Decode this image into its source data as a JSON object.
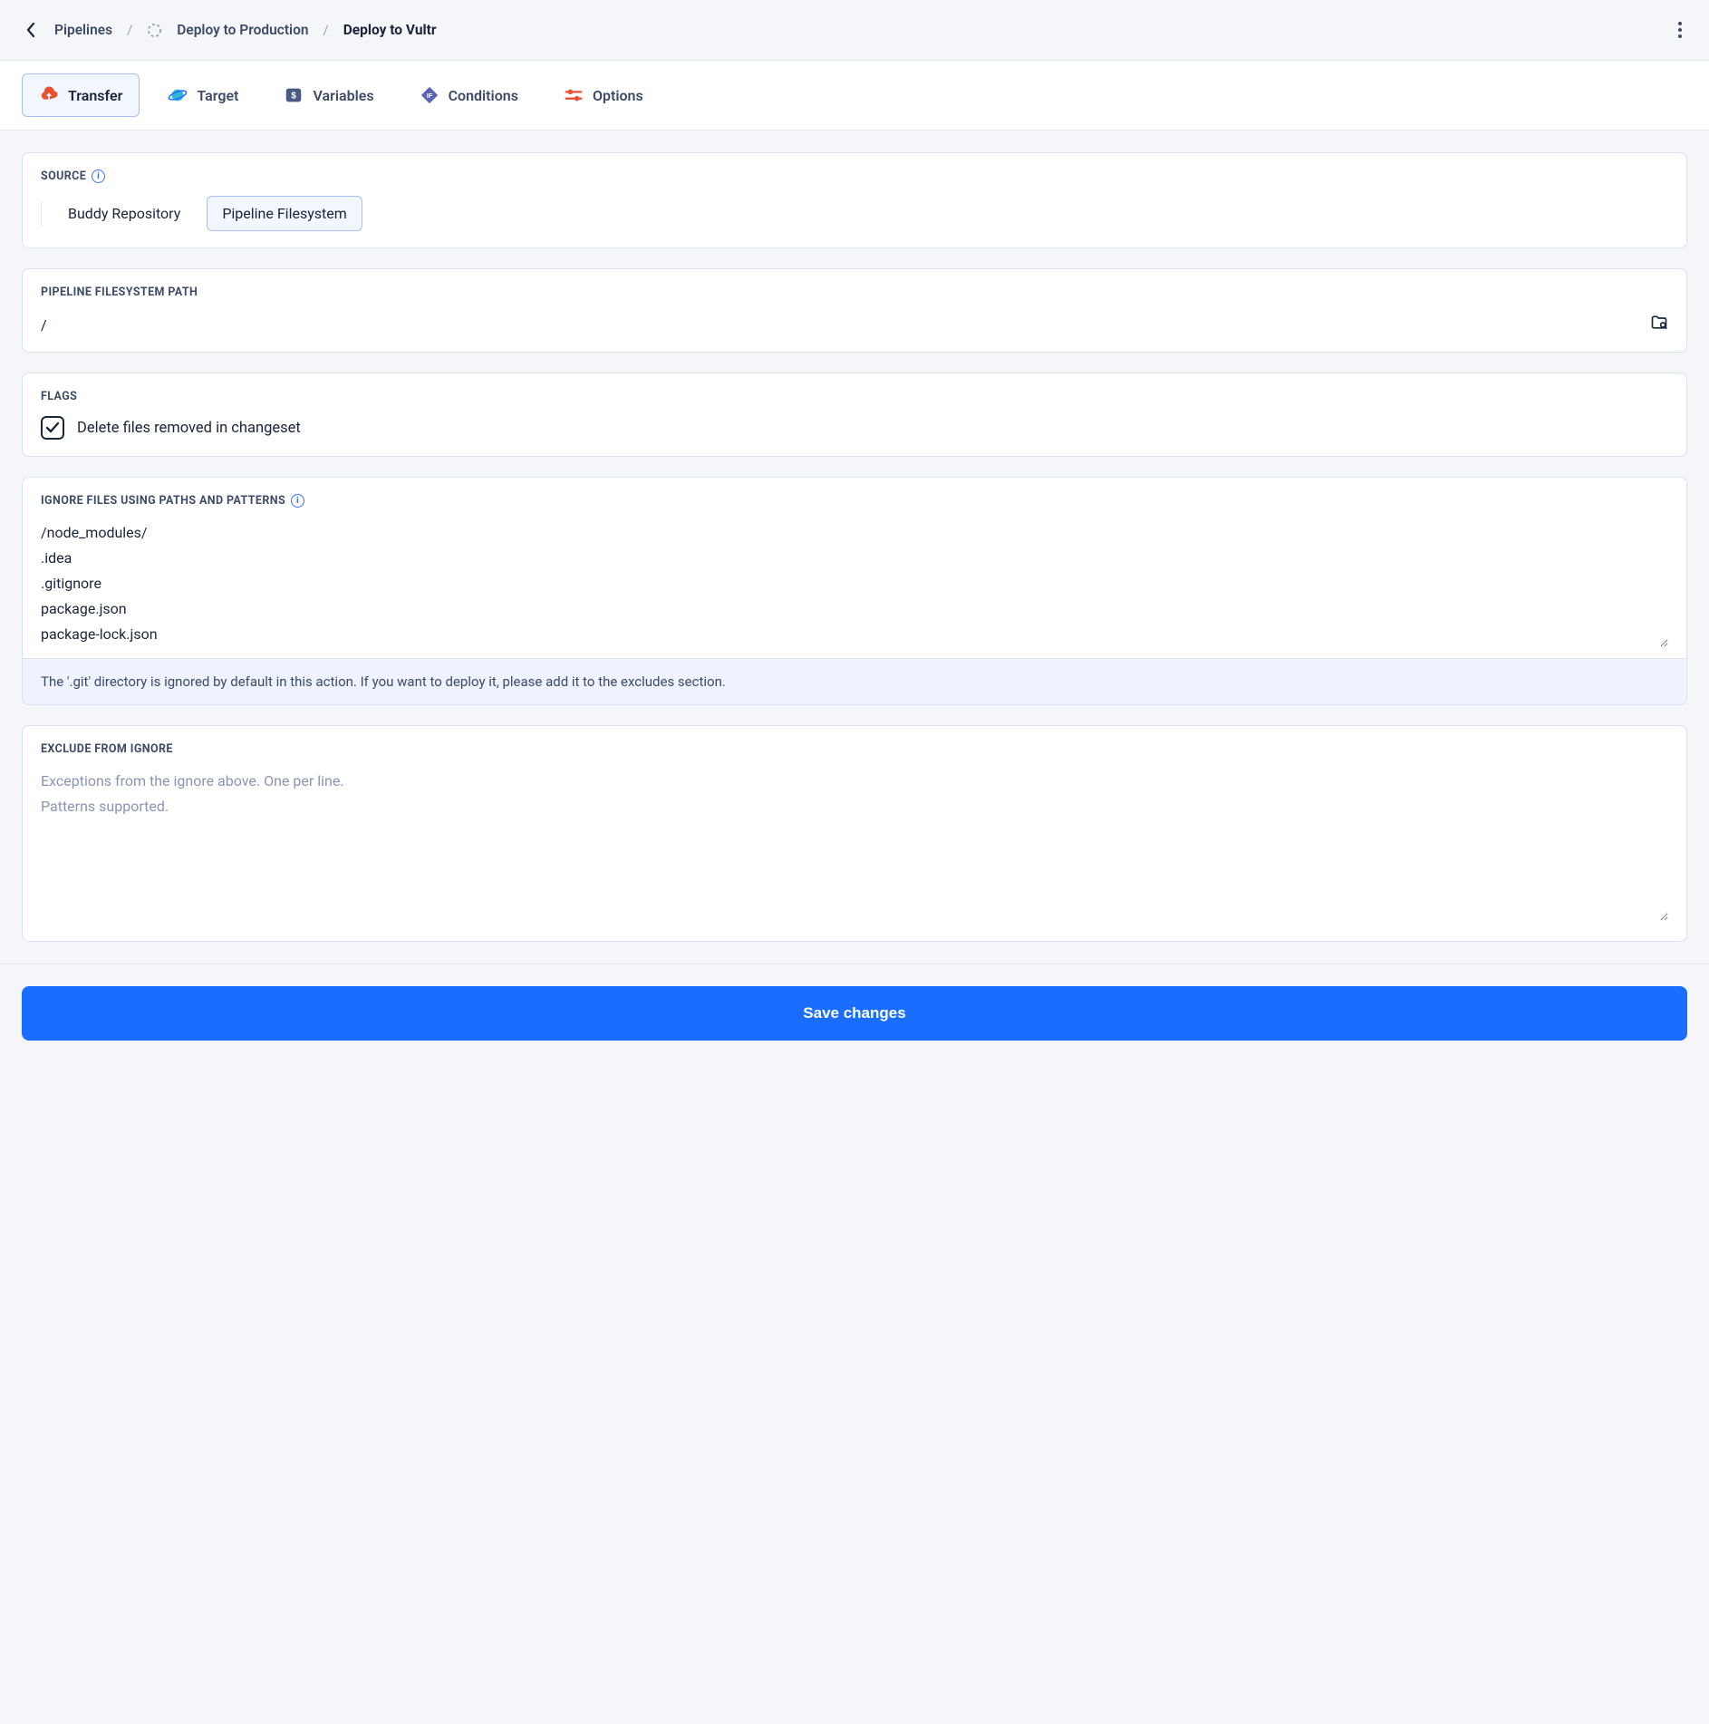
{
  "breadcrumb": {
    "root": "Pipelines",
    "parent": "Deploy to Production",
    "current": "Deploy to Vultr"
  },
  "tabs": [
    {
      "label": "Transfer",
      "active": true
    },
    {
      "label": "Target",
      "active": false
    },
    {
      "label": "Variables",
      "active": false
    },
    {
      "label": "Conditions",
      "active": false
    },
    {
      "label": "Options",
      "active": false
    }
  ],
  "source": {
    "label": "SOURCE",
    "options": [
      "Buddy Repository",
      "Pipeline Filesystem"
    ],
    "selected": "Pipeline Filesystem"
  },
  "path": {
    "label": "PIPELINE FILESYSTEM PATH",
    "value": "/"
  },
  "flags": {
    "label": "FLAGS",
    "delete_removed": {
      "label": "Delete files removed in changeset",
      "checked": true
    }
  },
  "ignore": {
    "label": "IGNORE FILES USING PATHS AND PATTERNS",
    "value": "/node_modules/\n.idea\n.gitignore\npackage.json\npackage-lock.json",
    "help": "The '.git' directory is ignored by default in this action. If you want to deploy it, please add it to the excludes section."
  },
  "exclude": {
    "label": "EXCLUDE FROM IGNORE",
    "placeholder": "Exceptions from the ignore above. One per line.\nPatterns supported.",
    "value": ""
  },
  "footer": {
    "save_label": "Save changes"
  }
}
